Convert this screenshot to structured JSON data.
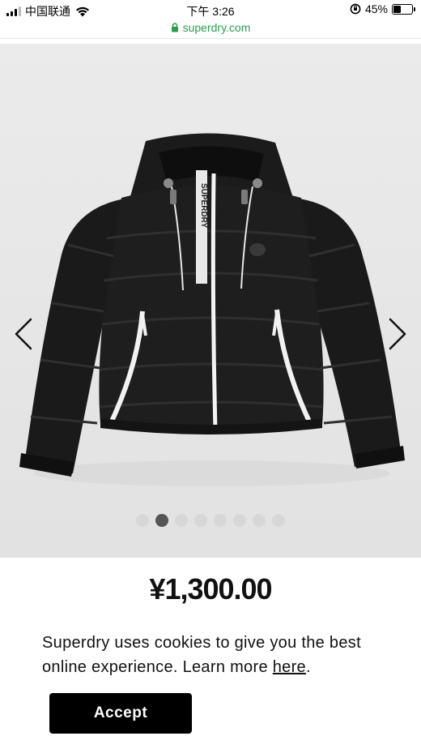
{
  "status_bar": {
    "carrier": "中国联通",
    "time": "下午 3:26",
    "battery_percent": "45%",
    "battery_level": 0.45
  },
  "url_bar": {
    "domain": "superdry.com"
  },
  "gallery": {
    "image_count": 8,
    "active_index": 1,
    "prev_icon": "chevron-left-icon",
    "next_icon": "chevron-right-icon"
  },
  "product": {
    "price": "¥1,300.00",
    "brand_print": "SUPERDRY"
  },
  "cookie_banner": {
    "text_before_link": "Superdry uses cookies to give you the best online experience. Learn more ",
    "link_label": "here",
    "text_after_link": ".",
    "accept_label": "Accept"
  },
  "colors": {
    "url_green": "#2a9d4b",
    "gallery_bg": "#e9e9e9",
    "button_bg": "#000000"
  }
}
